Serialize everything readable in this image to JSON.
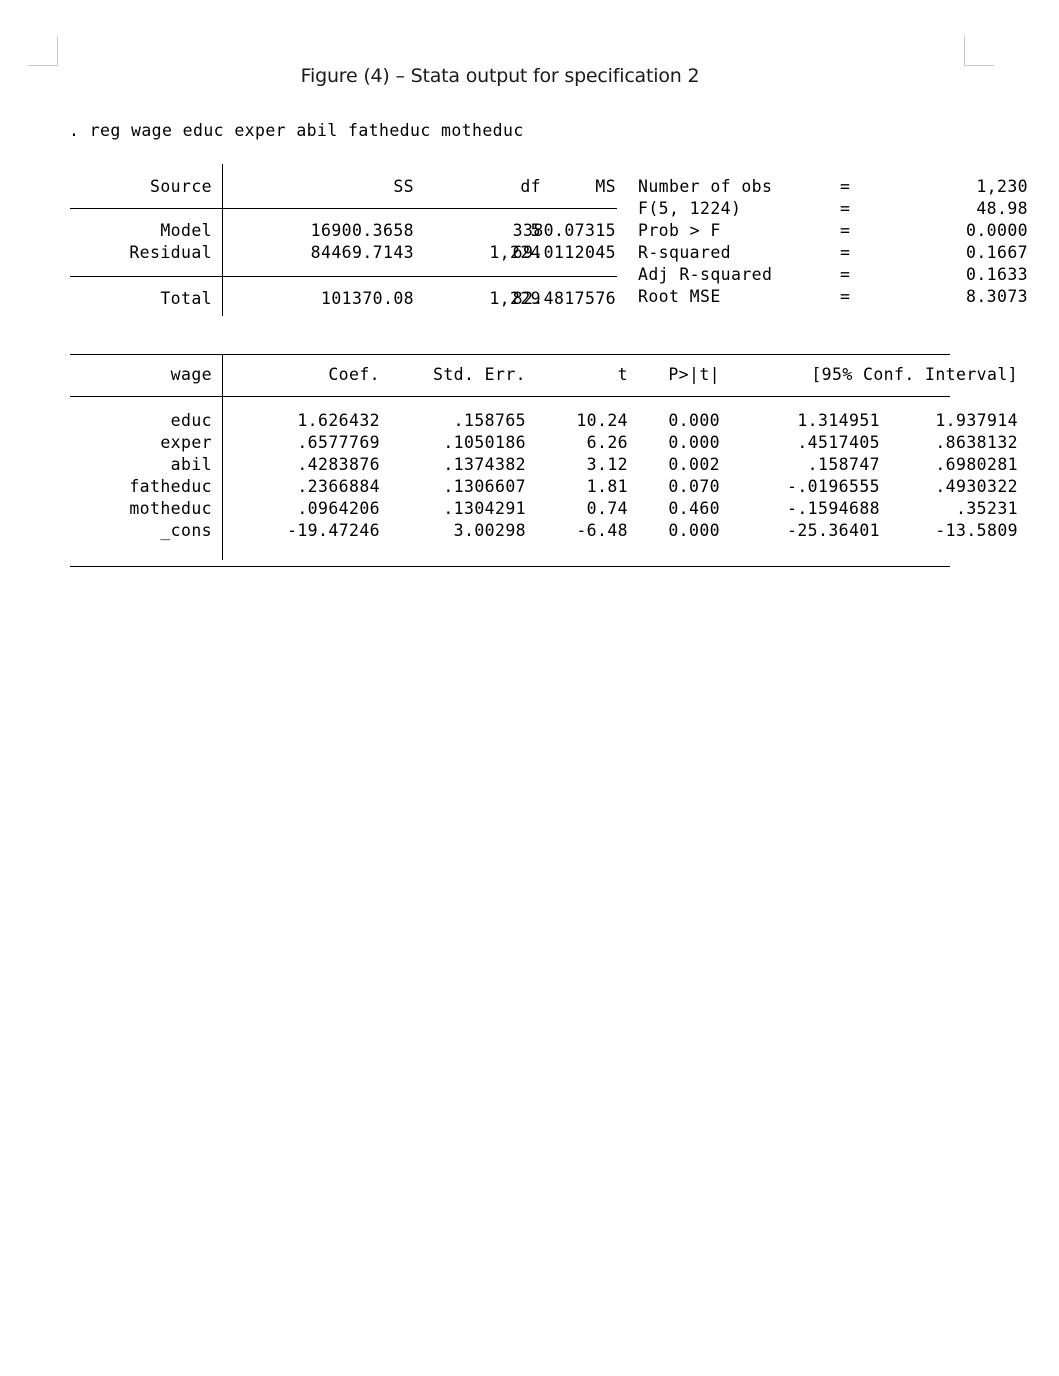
{
  "figure": {
    "title": "Figure (4) – Stata output for specification 2"
  },
  "console": {
    "command": ". reg wage educ exper abil fatheduc motheduc"
  },
  "anova": {
    "headers": {
      "source": "Source",
      "ss": "SS",
      "df": "df",
      "ms": "MS"
    },
    "rows": [
      {
        "source": "Model",
        "ss": "16900.3658",
        "df": "5",
        "ms": "3380.07315"
      },
      {
        "source": "Residual",
        "ss": "84469.7143",
        "df": "1,224",
        "ms": "69.0112045"
      },
      {
        "source": "Total",
        "ss": "101370.08",
        "df": "1,229",
        "ms": "82.4817576"
      }
    ]
  },
  "model_stats": [
    {
      "label": "Number of obs",
      "eq": "=",
      "value": "1,230"
    },
    {
      "label": "F(5, 1224)",
      "eq": "=",
      "value": "48.98"
    },
    {
      "label": "Prob > F",
      "eq": "=",
      "value": "0.0000"
    },
    {
      "label": "R-squared",
      "eq": "=",
      "value": "0.1667"
    },
    {
      "label": "Adj R-squared",
      "eq": "=",
      "value": "0.1633"
    },
    {
      "label": "Root MSE",
      "eq": "=",
      "value": "8.3073"
    }
  ],
  "coefficients": {
    "headers": {
      "depvar": "wage",
      "coef": "Coef.",
      "se": "Std. Err.",
      "t": "t",
      "p": "P>|t|",
      "ci": "[95% Conf. Interval]"
    },
    "rows": [
      {
        "var": "educ",
        "coef": "1.626432",
        "se": ".158765",
        "t": "10.24",
        "p": "0.000",
        "ci_low": "1.314951",
        "ci_high": "1.937914"
      },
      {
        "var": "exper",
        "coef": ".6577769",
        "se": ".1050186",
        "t": "6.26",
        "p": "0.000",
        "ci_low": ".4517405",
        "ci_high": ".8638132"
      },
      {
        "var": "abil",
        "coef": ".4283876",
        "se": ".1374382",
        "t": "3.12",
        "p": "0.002",
        "ci_low": ".158747",
        "ci_high": ".6980281"
      },
      {
        "var": "fatheduc",
        "coef": ".2366884",
        "se": ".1306607",
        "t": "1.81",
        "p": "0.070",
        "ci_low": "-.0196555",
        "ci_high": ".4930322"
      },
      {
        "var": "motheduc",
        "coef": ".0964206",
        "se": ".1304291",
        "t": "0.74",
        "p": "0.460",
        "ci_low": "-.1594688",
        "ci_high": ".35231"
      },
      {
        "var": "_cons",
        "coef": "-19.47246",
        "se": "3.00298",
        "t": "-6.48",
        "p": "0.000",
        "ci_low": "-25.36401",
        "ci_high": "-13.5809"
      }
    ]
  },
  "colors": {
    "text": "#000000",
    "rule": "#000000",
    "crop_mark": "#c8c8c8",
    "page_background": "#ffffff"
  }
}
